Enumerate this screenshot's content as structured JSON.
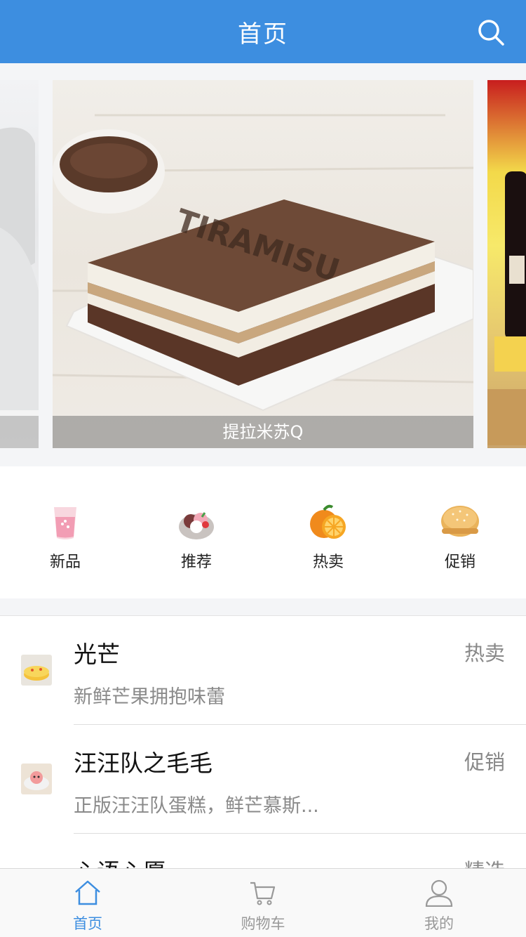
{
  "header": {
    "title": "首页"
  },
  "carousel": {
    "main_caption": "提拉米苏Q"
  },
  "categories": [
    {
      "label": "新品",
      "icon": "milk-cup-icon"
    },
    {
      "label": "推荐",
      "icon": "dessert-cup-icon"
    },
    {
      "label": "热卖",
      "icon": "orange-icon"
    },
    {
      "label": "促销",
      "icon": "burger-bun-icon"
    }
  ],
  "products": [
    {
      "name": "光芒",
      "tag": "热卖",
      "desc": "新鲜芒果拥抱味蕾"
    },
    {
      "name": "汪汪队之毛毛",
      "tag": "促销",
      "desc": "正版汪汪队蛋糕，鲜芒慕斯..."
    },
    {
      "name": "心语心愿",
      "tag": "精选",
      "desc": ""
    }
  ],
  "tabbar": [
    {
      "label": "首页",
      "icon": "home-icon",
      "active": true
    },
    {
      "label": "购物车",
      "icon": "cart-icon",
      "active": false
    },
    {
      "label": "我的",
      "icon": "user-icon",
      "active": false
    }
  ],
  "colors": {
    "primary": "#3d8ee0",
    "muted": "#999999"
  }
}
